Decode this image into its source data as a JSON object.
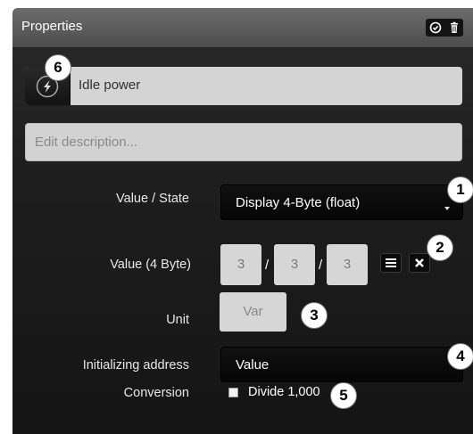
{
  "header": {
    "title": "Properties",
    "icons": [
      "check-circle-icon",
      "trash-icon"
    ]
  },
  "name_row": {
    "icon": "flash-circle-icon",
    "value": "Idle power"
  },
  "description": {
    "placeholder": "Edit description..."
  },
  "value_state": {
    "label": "Value / State",
    "selected": "Display 4-Byte (float)"
  },
  "value_4byte": {
    "label": "Value (4 Byte)",
    "values": [
      "3",
      "3",
      "3"
    ],
    "separator": "/"
  },
  "unit": {
    "label": "Unit",
    "value": "Var"
  },
  "initializing_address": {
    "label": "Initializing address",
    "selected": "Value"
  },
  "conversion": {
    "label": "Conversion",
    "checkbox_label": "Divide 1,000",
    "checked": false
  },
  "badges": [
    "1",
    "2",
    "3",
    "4",
    "5",
    "6"
  ],
  "colors": {
    "header": "#5b5b5b",
    "panel": "#1e1e1e",
    "input_bg": "#d6d6d6",
    "select_bg": "#0a0a0a"
  }
}
